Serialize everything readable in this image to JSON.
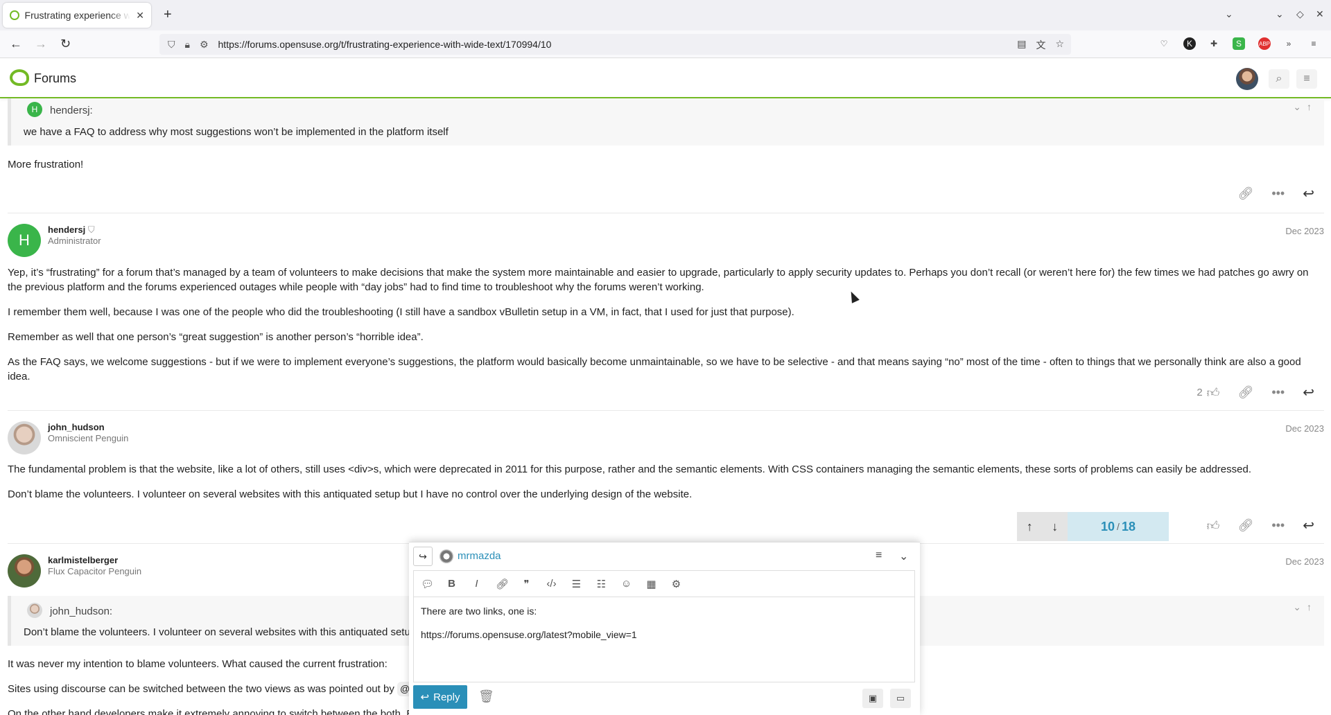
{
  "browser": {
    "tab_title": "Frustrating experience with wide text",
    "url": "https://forums.opensuse.org/t/frustrating-experience-with-wide-text/170994/10"
  },
  "header": {
    "site_title": "Forums"
  },
  "quote1": {
    "author_initial": "H",
    "author": "hendersj:",
    "text": "we have a FAQ to address why most suggestions won’t be implemented in the platform itself"
  },
  "post0": {
    "text": "More frustration!"
  },
  "post1": {
    "avatar_initial": "H",
    "username": "hendersj",
    "user_title": "Administrator",
    "date": "Dec 2023",
    "paragraphs": [
      "Yep, it’s “frustrating” for a forum that’s managed by a team of volunteers to make decisions that make the system more maintainable and easier to upgrade, particularly to apply security updates to. Perhaps you don’t recall (or weren’t here for) the few times we had patches go awry on the previous platform and the forums experienced outages while people with “day jobs” had to find time to troubleshoot why the forums weren’t working.",
      "I remember them well, because I was one of the people who did the troubleshooting (I still have a sandbox vBulletin setup in a VM, in fact, that I used for just that purpose).",
      "Remember as well that one person’s “great suggestion” is another person’s “horrible idea”.",
      "As the FAQ says, we welcome suggestions - but if we were to implement everyone’s suggestions, the platform would basically become unmaintainable, so we have to be selective - and that means saying “no” most of the time - often to things that we personally think are also a good idea."
    ],
    "likes": "2"
  },
  "post2": {
    "username": "john_hudson",
    "user_title": "Omniscient Penguin",
    "date": "Dec 2023",
    "paragraphs": [
      "The fundamental problem is that the website, like a lot of others, still uses <div>s, which were deprecated in 2011 for this purpose, rather and the semantic elements. With CSS containers managing the semantic elements, these sorts of problems can easily be addressed.",
      "Don’t blame the volunteers. I volunteer on several websites with this antiquated setup but I have no control over the underlying design of the website."
    ]
  },
  "timeline": {
    "current": "10",
    "total": "18"
  },
  "post3": {
    "username": "karlmistelberger",
    "user_title": "Flux Capacitor Penguin",
    "date": "Dec 2023",
    "quote_author": "john_hudson:",
    "quote_text": "Don’t blame the volunteers. I volunteer on several websites with this antiquated setup but",
    "p1": "It was never my intention to blame volunteers. What caused the current frustration:",
    "p2": "Sites using discourse can be switched between the two views as was pointed out by",
    "mention": "@arvidja",
    "p3": "On the other hand developers make it extremely annoying to switch between the both. Even"
  },
  "composer": {
    "username": "mrmazda",
    "line1": "There are two links, one is:",
    "line2": "https://forums.opensuse.org/latest?mobile_view=1",
    "reply_label": "Reply"
  }
}
